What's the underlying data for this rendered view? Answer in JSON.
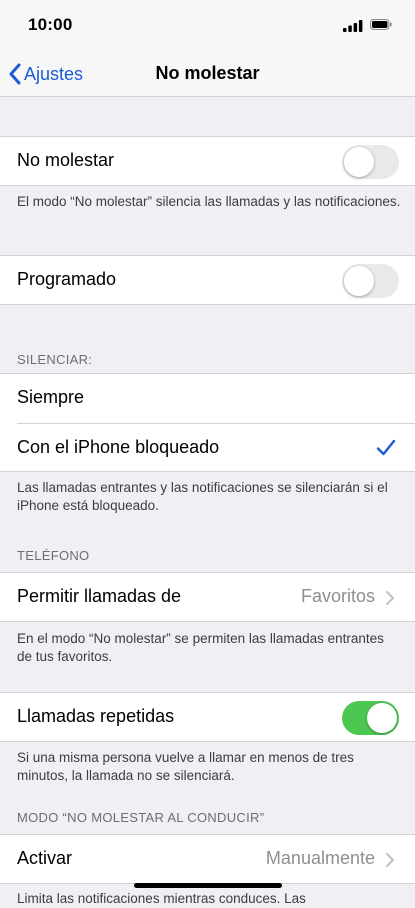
{
  "status_bar": {
    "time": "10:00"
  },
  "nav": {
    "back_label": "Ajustes",
    "title": "No molestar"
  },
  "dnd": {
    "label": "No molestar",
    "enabled": false,
    "footnote": "El modo “No molestar” silencia las llamadas y las notificaciones."
  },
  "scheduled": {
    "label": "Programado",
    "enabled": false
  },
  "silence": {
    "header": "SILENCIAR:",
    "options": [
      {
        "label": "Siempre",
        "selected": false
      },
      {
        "label": "Con el iPhone bloqueado",
        "selected": true
      }
    ],
    "footnote": "Las llamadas entrantes y las notificaciones se silenciarán si el iPhone está bloqueado."
  },
  "phone": {
    "header": "TELÉFONO",
    "allow_calls_label": "Permitir llamadas de",
    "allow_calls_value": "Favoritos",
    "footnote": "En el modo “No molestar” se permiten las llamadas entrantes de tus favoritos.",
    "repeated_label": "Llamadas repetidas",
    "repeated_enabled": true,
    "repeated_footnote": "Si una misma persona vuelve a llamar en menos de tres minutos, la llamada no se silenciará."
  },
  "driving": {
    "header": "MODO “NO MOLESTAR AL CONDUCIR”",
    "activate_label": "Activar",
    "activate_value": "Manualmente",
    "footnote_partial": "Limita las notificaciones mientras conduces. Las"
  },
  "colors": {
    "accent": "#1b5bd6",
    "toggle_on": "#4cc752",
    "background": "#efeff4"
  }
}
